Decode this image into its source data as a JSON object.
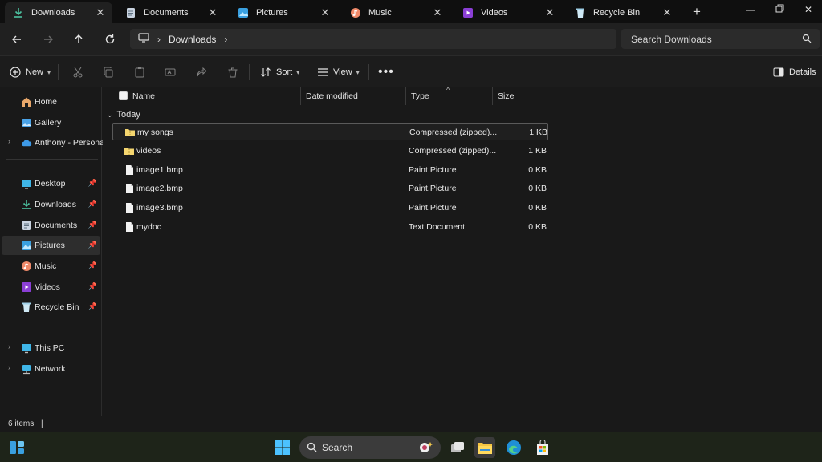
{
  "tabs": [
    {
      "label": "Downloads",
      "icon": "download-icon",
      "active": true
    },
    {
      "label": "Documents",
      "icon": "document-icon",
      "active": false
    },
    {
      "label": "Pictures",
      "icon": "pictures-icon",
      "active": false
    },
    {
      "label": "Music",
      "icon": "music-icon",
      "active": false
    },
    {
      "label": "Videos",
      "icon": "videos-icon",
      "active": false
    },
    {
      "label": "Recycle Bin",
      "icon": "recycle-bin-icon",
      "active": false
    }
  ],
  "address": {
    "path": [
      "Downloads"
    ],
    "search_placeholder": "Search Downloads"
  },
  "commandbar": {
    "new_label": "New",
    "sort_label": "Sort",
    "view_label": "View",
    "details_label": "Details"
  },
  "sidebar": {
    "quick": [
      {
        "label": "Home",
        "icon": "home-icon"
      },
      {
        "label": "Gallery",
        "icon": "gallery-icon"
      },
      {
        "label": "Anthony - Personal",
        "icon": "onedrive-icon"
      }
    ],
    "pinned": [
      {
        "label": "Desktop",
        "icon": "desktop-icon"
      },
      {
        "label": "Downloads",
        "icon": "download-icon"
      },
      {
        "label": "Documents",
        "icon": "document-icon"
      },
      {
        "label": "Pictures",
        "icon": "pictures-icon"
      },
      {
        "label": "Music",
        "icon": "music-icon"
      },
      {
        "label": "Videos",
        "icon": "videos-icon"
      },
      {
        "label": "Recycle Bin",
        "icon": "recycle-bin-icon"
      }
    ],
    "devices": [
      {
        "label": "This PC",
        "icon": "computer-icon"
      },
      {
        "label": "Network",
        "icon": "network-icon"
      }
    ]
  },
  "columns": [
    "Name",
    "Date modified",
    "Type",
    "Size"
  ],
  "group_label": "Today",
  "files": [
    {
      "name": "my songs",
      "type": "Compressed (zipped)...",
      "size": "1 KB",
      "icon": "zip-folder-icon"
    },
    {
      "name": "videos",
      "type": "Compressed (zipped)...",
      "size": "1 KB",
      "icon": "zip-folder-icon"
    },
    {
      "name": "image1.bmp",
      "type": "Paint.Picture",
      "size": "0 KB",
      "icon": "file-icon"
    },
    {
      "name": "image2.bmp",
      "type": "Paint.Picture",
      "size": "0 KB",
      "icon": "file-icon"
    },
    {
      "name": "image3.bmp",
      "type": "Paint.Picture",
      "size": "0 KB",
      "icon": "file-icon"
    },
    {
      "name": "mydoc",
      "type": "Text Document",
      "size": "0 KB",
      "icon": "file-icon"
    }
  ],
  "status": {
    "item_count": "6 items"
  },
  "taskbar": {
    "search_label": "Search"
  },
  "colors": {
    "accent": "#4cc2ff",
    "folder": "#f5d66f"
  }
}
